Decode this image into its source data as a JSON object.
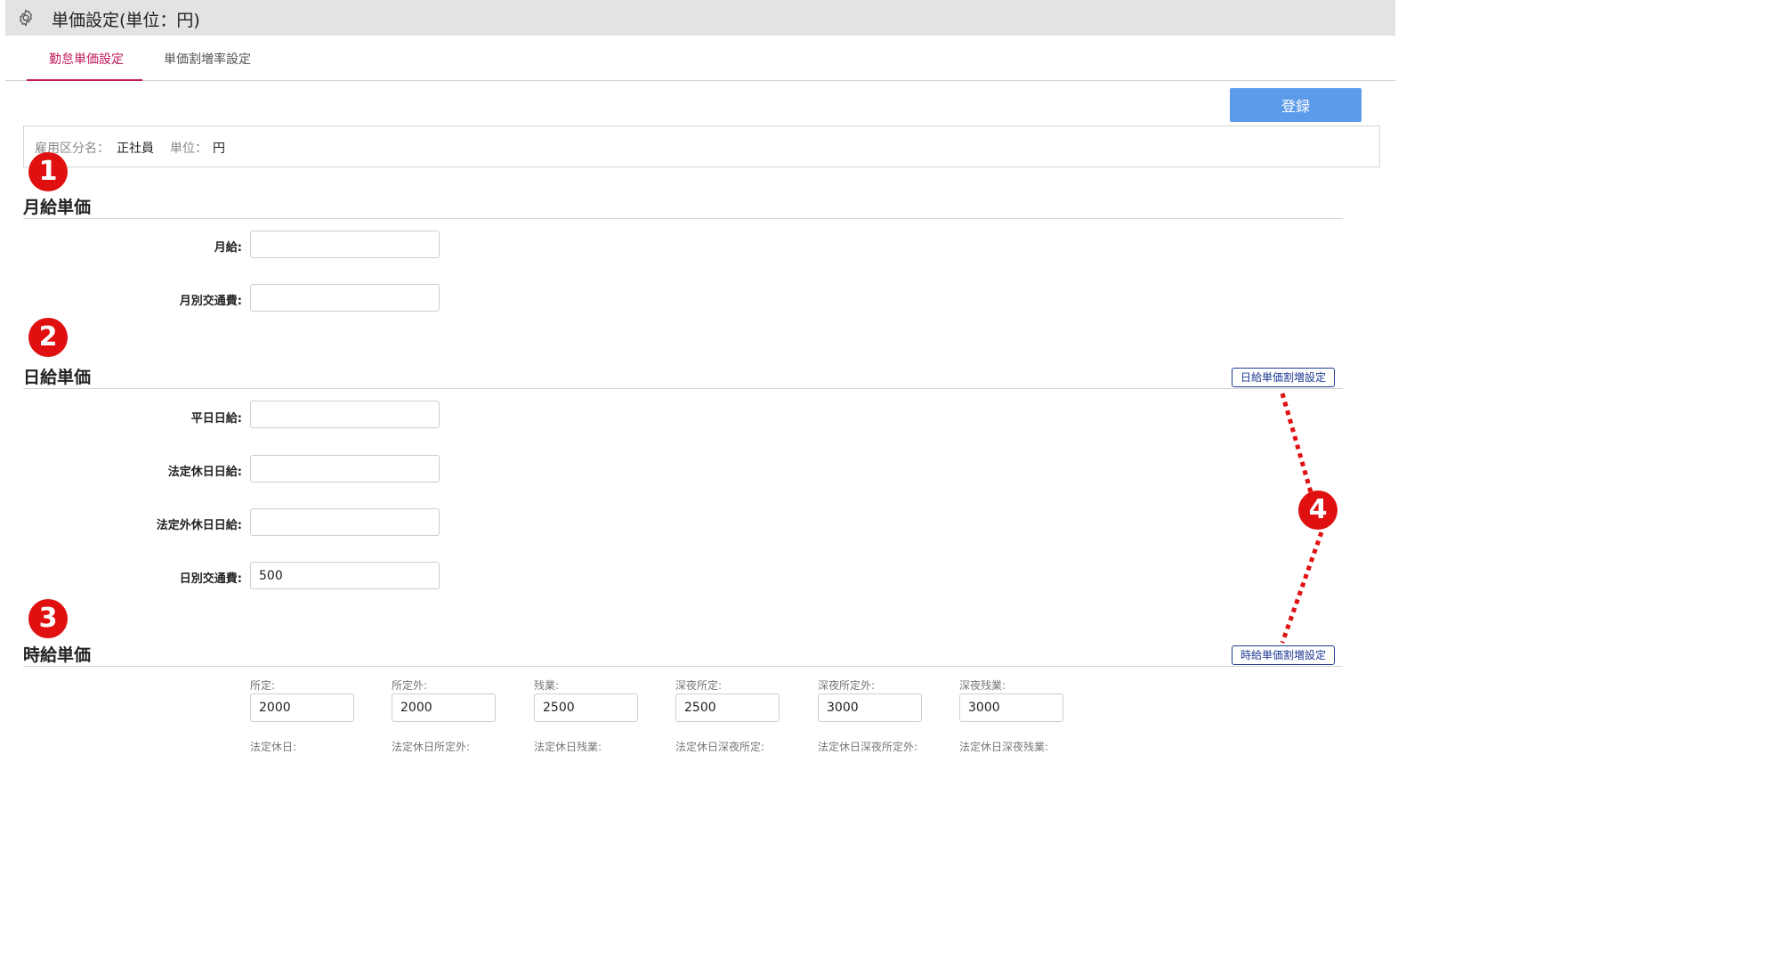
{
  "header": {
    "title": "単価設定(単位：円)",
    "icon": "gear-icon"
  },
  "tabs": [
    {
      "label": "勤怠単価設定",
      "active": true
    },
    {
      "label": "単価割増率設定",
      "active": false
    }
  ],
  "toolbar": {
    "register_label": "登録"
  },
  "info": {
    "employment_label": "雇用区分名：",
    "employment_value": "正社員",
    "unit_label": "単位：",
    "unit_value": "円"
  },
  "markers": [
    "1",
    "2",
    "3",
    "4"
  ],
  "monthly": {
    "title": "月給単価",
    "fields": [
      {
        "label": "月給:",
        "value": ""
      },
      {
        "label": "月別交通費:",
        "value": ""
      }
    ]
  },
  "daily": {
    "title": "日給単価",
    "premium_button": "日給単価割増設定",
    "fields": [
      {
        "label": "平日日給:",
        "value": ""
      },
      {
        "label": "法定休日日給:",
        "value": ""
      },
      {
        "label": "法定外休日日給:",
        "value": ""
      },
      {
        "label": "日別交通費:",
        "value": "500"
      }
    ]
  },
  "hourly": {
    "title": "時給単価",
    "premium_button": "時給単価割増設定",
    "fields": [
      {
        "label": "所定:",
        "value": "2000"
      },
      {
        "label": "所定外:",
        "value": "2000"
      },
      {
        "label": "残業:",
        "value": "2500"
      },
      {
        "label": "深夜所定:",
        "value": "2500"
      },
      {
        "label": "深夜所定外:",
        "value": "3000"
      },
      {
        "label": "深夜残業:",
        "value": "3000"
      }
    ],
    "next_row_labels": [
      "法定休日:",
      "法定休日所定外:",
      "法定休日残業:",
      "法定休日深夜所定:",
      "法定休日深夜所定外:",
      "法定休日深夜残業:"
    ]
  },
  "colors": {
    "accent_tab": "#c2185b",
    "register_button": "#5b9be8",
    "marker": "#e01010",
    "premium_button_border": "#1f3a93"
  }
}
